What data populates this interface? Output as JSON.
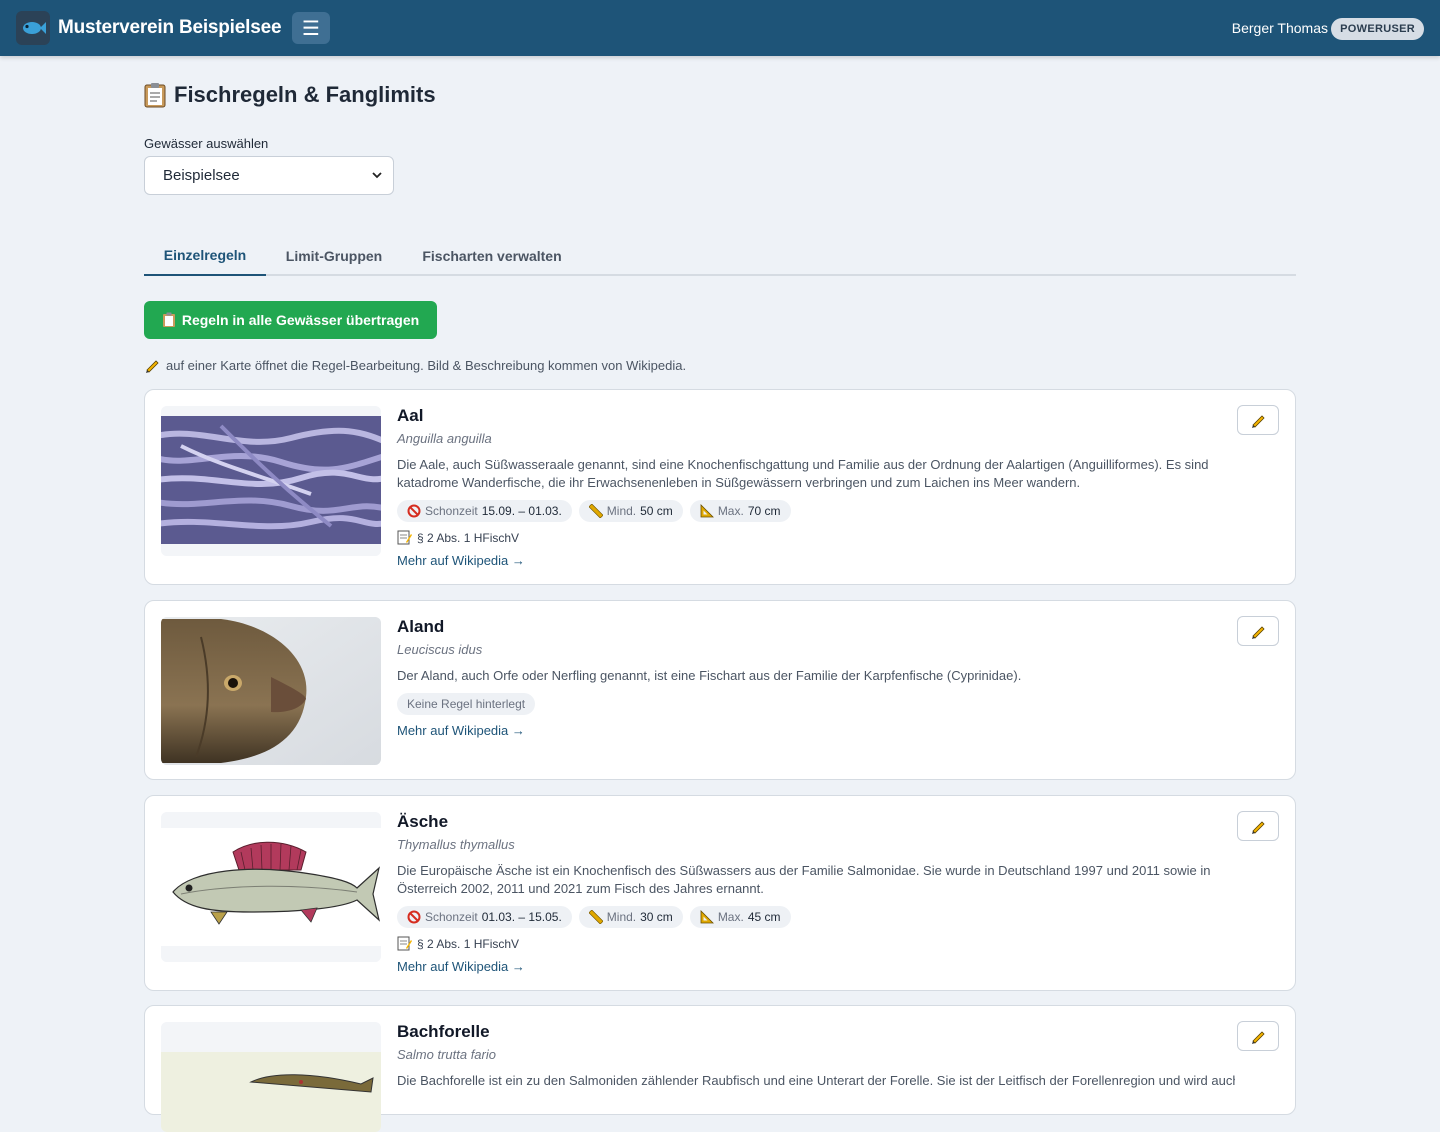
{
  "header": {
    "brand_name": "Musterverein Beispielsee",
    "menu_icon": "☰",
    "user_name": "Berger Thomas",
    "role": "POWERUSER"
  },
  "page": {
    "title": "Fischregeln & Fanglimits",
    "select_label": "Gewässer auswählen",
    "selected_water": "Beispielsee"
  },
  "tabs": [
    {
      "label": "Einzelregeln",
      "active": true
    },
    {
      "label": "Limit-Gruppen",
      "active": false
    },
    {
      "label": "Fischarten verwalten",
      "active": false
    }
  ],
  "actions": {
    "transfer_label": "Regeln in alle Gewässer übertragen",
    "hint": "auf einer Karte öffnet die Regel-Bearbeitung. Bild & Beschreibung kommen von Wikipedia."
  },
  "labels": {
    "schonzeit": "Schonzeit",
    "mind": "Mind.",
    "max": "Max.",
    "wiki_link": "Mehr auf Wikipedia →",
    "no_rule": "Keine Regel hinterlegt"
  },
  "fish": [
    {
      "name": "Aal",
      "scientific": "Anguilla anguilla",
      "description": "Die Aale, auch Süßwasseraale genannt, sind eine Knochenfischgattung und Familie aus der Ordnung der Aalartigen (Anguilliformes). Es sind katadrome Wanderfische, die ihr Erwachsenenleben in Süßgewässern verbringen und zum Laichen ins Meer wandern.",
      "schonzeit": "15.09. – 01.03.",
      "min": "50 cm",
      "max": "70 cm",
      "law": "§ 2 Abs. 1 HFischV"
    },
    {
      "name": "Aland",
      "scientific": "Leuciscus idus",
      "description": "Der Aland, auch Orfe oder Nerfling genannt, ist eine Fischart aus der Familie der Karpfenfische (Cyprinidae)."
    },
    {
      "name": "Äsche",
      "scientific": "Thymallus thymallus",
      "description": "Die Europäische Äsche ist ein Knochenfisch des Süßwassers aus der Familie Salmonidae. Sie wurde in Deutschland 1997 und 2011 sowie in Österreich 2002, 2011 und 2021 zum Fisch des Jahres ernannt.",
      "schonzeit": "01.03. – 15.05.",
      "min": "30 cm",
      "max": "45 cm",
      "law": "§ 2 Abs. 1 HFischV"
    },
    {
      "name": "Bachforelle",
      "scientific": "Salmo trutta fario",
      "description": "Die Bachforelle ist ein zu den Salmoniden zählender Raubfisch und eine Unterart der Forelle. Sie ist der Leitfisch der Forellenregion und wird auch"
    }
  ],
  "colors": {
    "header_bg": "#1e5478",
    "accent": "#1e5478",
    "success": "#22a851",
    "page_bg": "#eef2f7"
  }
}
